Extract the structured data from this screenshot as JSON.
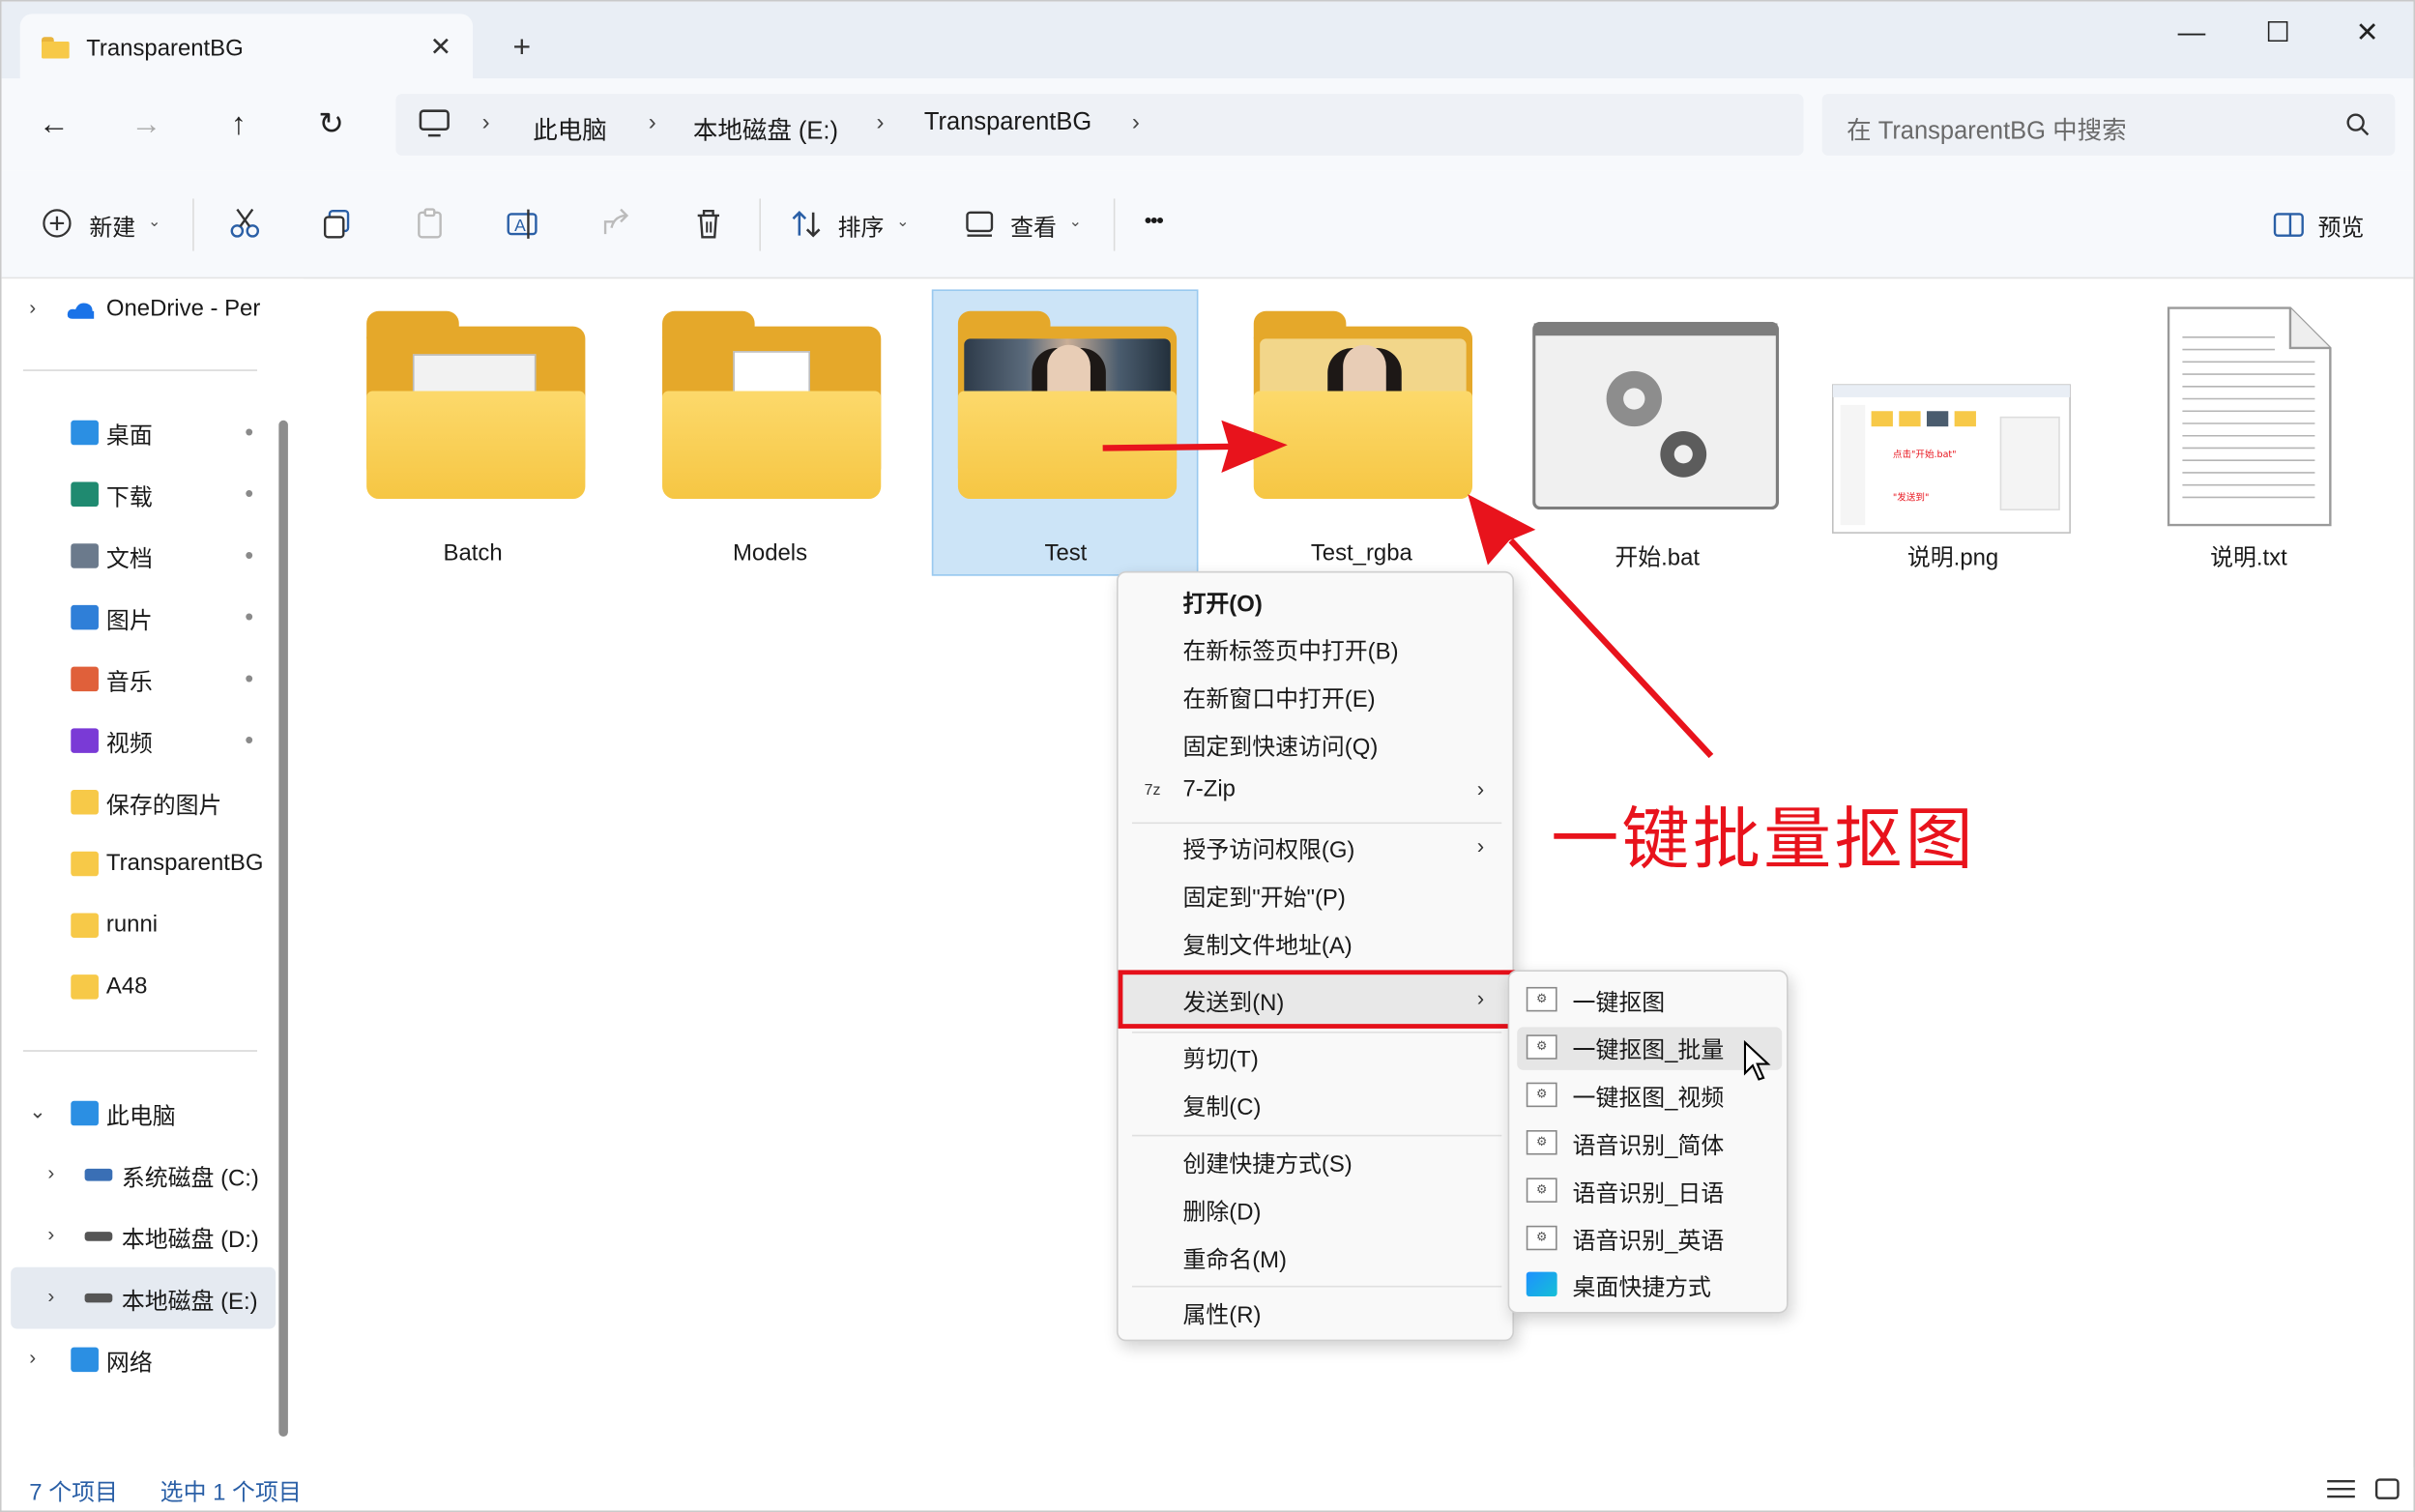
{
  "window": {
    "tab_title": "TransparentBG",
    "tab_close": "✕",
    "new_tab": "+",
    "minimize": "—",
    "maximize": "☐",
    "close": "✕"
  },
  "nav": {
    "back": "←",
    "forward": "→",
    "up": "↑",
    "refresh": "↻",
    "breadcrumbs": [
      "此电脑",
      "本地磁盘 (E:)",
      "TransparentBG"
    ],
    "chevron": "›",
    "search_placeholder": "在 TransparentBG 中搜索"
  },
  "toolbar": {
    "new_label": "新建",
    "sort_label": "排序",
    "view_label": "查看",
    "more": "•••",
    "preview_label": "预览",
    "caret": "⌄"
  },
  "sidebar": {
    "onedrive": "OneDrive - Per",
    "quick": [
      {
        "label": "桌面",
        "icon": "desktop-icon",
        "color": "#2b8fe3"
      },
      {
        "label": "下载",
        "icon": "download-icon",
        "color": "#1f8a70"
      },
      {
        "label": "文档",
        "icon": "document-icon",
        "color": "#6b7a8c"
      },
      {
        "label": "图片",
        "icon": "pictures-icon",
        "color": "#2f7fd8"
      },
      {
        "label": "音乐",
        "icon": "music-icon",
        "color": "#e0603a"
      },
      {
        "label": "视频",
        "icon": "video-icon",
        "color": "#7a3ad6"
      },
      {
        "label": "保存的图片",
        "icon": "folder-icon",
        "color": "#f7c948"
      },
      {
        "label": "TransparentBG",
        "icon": "folder-icon",
        "color": "#f7c948"
      },
      {
        "label": "runni",
        "icon": "folder-icon",
        "color": "#f7c948"
      },
      {
        "label": "A48",
        "icon": "folder-icon",
        "color": "#f7c948"
      }
    ],
    "this_pc": "此电脑",
    "drives": [
      "系统磁盘 (C:)",
      "本地磁盘 (D:)",
      "本地磁盘 (E:)"
    ],
    "network": "网络",
    "pin": "📌",
    "expand": "›",
    "expanded": "⌄"
  },
  "items": [
    {
      "name": "Batch",
      "kind": "folder-app"
    },
    {
      "name": "Models",
      "kind": "folder-doc"
    },
    {
      "name": "Test",
      "kind": "folder-photo",
      "selected": true
    },
    {
      "name": "Test_rgba",
      "kind": "folder-photo"
    },
    {
      "name": "开始.bat",
      "kind": "bat"
    },
    {
      "name": "说明.png",
      "kind": "png"
    },
    {
      "name": "说明.txt",
      "kind": "txt"
    }
  ],
  "context_menu": {
    "items": [
      "打开(O)",
      "在新标签页中打开(B)",
      "在新窗口中打开(E)",
      "固定到快速访问(Q)",
      "7-Zip",
      "授予访问权限(G)",
      "固定到\"开始\"(P)",
      "复制文件地址(A)",
      "发送到(N)",
      "剪切(T)",
      "复制(C)",
      "创建快捷方式(S)",
      "删除(D)",
      "重命名(M)",
      "属性(R)"
    ],
    "submenu_arrow": "›",
    "zip_icon": "7z"
  },
  "send_to_menu": {
    "items": [
      "一键抠图",
      "一键抠图_批量",
      "一键抠图_视频",
      "语音识别_简体",
      "语音识别_日语",
      "语音识别_英语",
      "桌面快捷方式"
    ],
    "shortcut_icon": "⚙"
  },
  "annotation": {
    "text": "一键批量抠图",
    "color": "#e8131c"
  },
  "status": {
    "count": "7 个项目",
    "selected": "选中 1 个项目"
  },
  "colors": {
    "accent": "#2a5fa6",
    "selection": "#cce4f7",
    "highlight_border": "#e5101a"
  }
}
